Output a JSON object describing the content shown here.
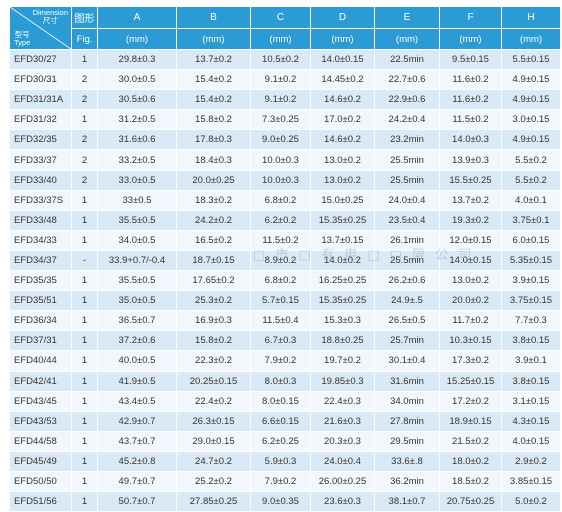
{
  "header": {
    "corner_dimension_en": "Dimension",
    "corner_dimension_cn": "尺寸",
    "corner_type_cn": "型号",
    "corner_type_en": "Type",
    "fig_cn": "图形",
    "fig_en": "Fig.",
    "columns": [
      "A",
      "B",
      "C",
      "D",
      "E",
      "F",
      "H"
    ],
    "unit": "(mm)"
  },
  "rows": [
    {
      "type": "EFD30/27",
      "fig": "1",
      "a": "29.8±0.3",
      "b": "13.7±0.2",
      "c": "10.5±0.2",
      "d": "14.0±0.15",
      "e": "22.5min",
      "f": "9.5±0.15",
      "h": "5.5±0.15"
    },
    {
      "type": "EFD30/31",
      "fig": "2",
      "a": "30.0±0.5",
      "b": "15.4±0.2",
      "c": "9.1±0.2",
      "d": "14.45±0.2",
      "e": "22.7±0.6",
      "f": "11.6±0.2",
      "h": "4.9±0.15"
    },
    {
      "type": "EFD31/31A",
      "fig": "2",
      "a": "30.5±0.6",
      "b": "15.4±0.2",
      "c": "9.1±0.2",
      "d": "14.6±0.2",
      "e": "22.9±0.6",
      "f": "11.6±0.2",
      "h": "4.9±0.15"
    },
    {
      "type": "EFD31/32",
      "fig": "1",
      "a": "31.2±0.5",
      "b": "15.8±0.2",
      "c": "7.3±0.25",
      "d": "17.0±0.2",
      "e": "24.2±0.4",
      "f": "11.5±0.2",
      "h": "3.0±0.15"
    },
    {
      "type": "EFD32/35",
      "fig": "2",
      "a": "31.6±0.6",
      "b": "17.8±0.3",
      "c": "9.0±0.25",
      "d": "14.6±0.2",
      "e": "23.2min",
      "f": "14.0±0.3",
      "h": "4.9±0.15"
    },
    {
      "type": "EFD33/37",
      "fig": "2",
      "a": "33.2±0.5",
      "b": "18.4±0.3",
      "c": "10.0±0.3",
      "d": "13.0±0.2",
      "e": "25.5min",
      "f": "13.9±0.3",
      "h": "5.5±0.2"
    },
    {
      "type": "EFD33/40",
      "fig": "2",
      "a": "33.0±0.5",
      "b": "20.0±0.25",
      "c": "10.0±0.3",
      "d": "13.0±0.2",
      "e": "25.5min",
      "f": "15.5±0.25",
      "h": "5.5±0.2"
    },
    {
      "type": "EFD33/37S",
      "fig": "1",
      "a": "33±0.5",
      "b": "18.3±0.2",
      "c": "6.8±0.2",
      "d": "15.0±0.25",
      "e": "24.0±0.4",
      "f": "13.7±0.2",
      "h": "4.0±0.1"
    },
    {
      "type": "EFD33/48",
      "fig": "1",
      "a": "35.5±0.5",
      "b": "24.2±0.2",
      "c": "6.2±0.2",
      "d": "15.35±0.25",
      "e": "23.5±0.4",
      "f": "19.3±0.2",
      "h": "3.75±0.1"
    },
    {
      "type": "EFD34/33",
      "fig": "1",
      "a": "34.0±0.5",
      "b": "16.5±0.2",
      "c": "11.5±0.2",
      "d": "13.7±0.15",
      "e": "26.1min",
      "f": "12.0±0.15",
      "h": "6.0±0.15"
    },
    {
      "type": "EFD34/37",
      "fig": "-",
      "a": "33.9+0.7/-0.4",
      "b": "18.7±0.15",
      "c": "8.9±0.2",
      "d": "14.0±0.2",
      "e": "25.5min",
      "f": "14.0±0.15",
      "h": "5.35±0.15"
    },
    {
      "type": "EFD35/35",
      "fig": "1",
      "a": "35.5±0.5",
      "b": "17.65±0.2",
      "c": "6.8±0.2",
      "d": "16.25±0.25",
      "e": "26.2±0.6",
      "f": "13.0±0.2",
      "h": "3.9±0.15"
    },
    {
      "type": "EFD35/51",
      "fig": "1",
      "a": "35.0±0.5",
      "b": "25.3±0.2",
      "c": "5.7±0.15",
      "d": "15.35±0.25",
      "e": "24.9±.5",
      "f": "20.0±0.2",
      "h": "3.75±0.15"
    },
    {
      "type": "EFD36/34",
      "fig": "1",
      "a": "36.5±0.7",
      "b": "16.9±0.3",
      "c": "11.5±0.4",
      "d": "15.3±0.3",
      "e": "26.5±0.5",
      "f": "11.7±0.2",
      "h": "7.7±0.3"
    },
    {
      "type": "EFD37/31",
      "fig": "1",
      "a": "37.2±0.6",
      "b": "15.8±0.2",
      "c": "6.7±0.3",
      "d": "18.8±0.25",
      "e": "25.7min",
      "f": "10.3±0.15",
      "h": "3.8±0.15"
    },
    {
      "type": "EFD40/44",
      "fig": "1",
      "a": "40.0±0.5",
      "b": "22.3±0.2",
      "c": "7.9±0.2",
      "d": "19.7±0.2",
      "e": "30.1±0.4",
      "f": "17.3±0.2",
      "h": "3.9±0.1"
    },
    {
      "type": "EFD42/41",
      "fig": "1",
      "a": "41.9±0.5",
      "b": "20.25±0.15",
      "c": "8.0±0.3",
      "d": "19.85±0.3",
      "e": "31.6min",
      "f": "15.25±0.15",
      "h": "3.8±0.15"
    },
    {
      "type": "EFD43/45",
      "fig": "1",
      "a": "43.4±0.5",
      "b": "22.4±0.2",
      "c": "8.0±0.15",
      "d": "22.4±0.3",
      "e": "34.0min",
      "f": "17.2±0.2",
      "h": "3.1±0.15"
    },
    {
      "type": "EFD43/53",
      "fig": "1",
      "a": "42.9±0.7",
      "b": "26.3±0.15",
      "c": "6.6±0.15",
      "d": "21.6±0.3",
      "e": "27.8min",
      "f": "18.9±0.15",
      "h": "4.3±0.15"
    },
    {
      "type": "EFD44/58",
      "fig": "1",
      "a": "43.7±0.7",
      "b": "29.0±0.15",
      "c": "6.2±0.25",
      "d": "20.3±0.3",
      "e": "29.5min",
      "f": "21.5±0.2",
      "h": "4.0±0.15"
    },
    {
      "type": "EFD45/49",
      "fig": "1",
      "a": "45.2±0.8",
      "b": "24.7±0.2",
      "c": "5.9±0.3",
      "d": "24.0±0.4",
      "e": "33.6±.8",
      "f": "18.0±0.2",
      "h": "2.9±0.2"
    },
    {
      "type": "EFD50/50",
      "fig": "1",
      "a": "49.7±0.7",
      "b": "25.2±0.2",
      "c": "7.9±0.2",
      "d": "26.00±0.25",
      "e": "36.2min",
      "f": "18.5±0.2",
      "h": "3.85±0.15"
    },
    {
      "type": "EFD51/56",
      "fig": "1",
      "a": "50.7±0.7",
      "b": "27.85±0.25",
      "c": "9.0±0.35",
      "d": "23.6±0.3",
      "e": "38.1±0.7",
      "f": "20.75±0.25",
      "h": "5.0±0.2"
    }
  ],
  "watermark": "□ 市 □ 有 电 □ □ 限 公 司",
  "colors": {
    "header_bg": "#2b9bd5",
    "row_odd": "#d9eaf6",
    "row_even": "#f1f7fc",
    "text": "#333333"
  }
}
